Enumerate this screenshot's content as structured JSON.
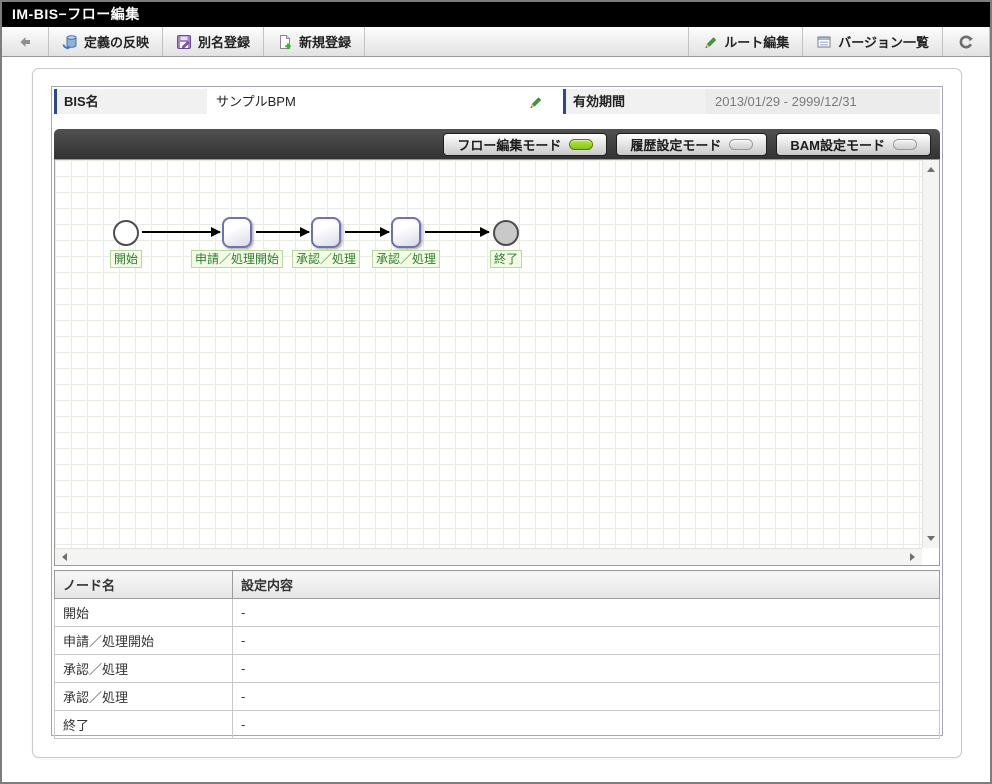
{
  "titlebar": {
    "title": "IM-BIS−フロー編集"
  },
  "toolbar": {
    "left": [
      {
        "label": "定義の反映",
        "icon": "database-sync-icon"
      },
      {
        "label": "別名登録",
        "icon": "floppy-save-icon"
      },
      {
        "label": "新規登録",
        "icon": "document-add-icon"
      }
    ],
    "right": [
      {
        "label": "ルート編集",
        "icon": "pencil-icon"
      },
      {
        "label": "バージョン一覧",
        "icon": "list-icon"
      }
    ],
    "icons": [
      "back-arrow-icon",
      "refresh-icon"
    ]
  },
  "form": {
    "bis_name_label": "BIS名",
    "bis_name_value": "サンプルBPM",
    "edit_icon": "pencil-icon",
    "period_label": "有効期間",
    "period_value": "2013/01/29 - 2999/12/31"
  },
  "modes": [
    {
      "label": "フロー編集モード",
      "active": true
    },
    {
      "label": "履歴設定モード",
      "active": false
    },
    {
      "label": "BAM設定モード",
      "active": false
    }
  ],
  "flow": {
    "nodes": [
      {
        "type": "start",
        "label": "開始"
      },
      {
        "type": "task",
        "label": "申請／処理開始"
      },
      {
        "type": "task",
        "label": "承認／処理"
      },
      {
        "type": "task",
        "label": "承認／処理"
      },
      {
        "type": "end",
        "label": "終了"
      }
    ]
  },
  "table": {
    "headers": [
      "ノード名",
      "設定内容"
    ],
    "rows": [
      [
        "開始",
        "-"
      ],
      [
        "申請／処理開始",
        "-"
      ],
      [
        "承認／処理",
        "-"
      ],
      [
        "承認／処理",
        "-"
      ],
      [
        "終了",
        "-"
      ]
    ]
  },
  "colors": {
    "titlebar_bg": "#000000",
    "accent_navy": "#2c4a8c",
    "led_active_green": "#8fd01f",
    "node_border_blue": "#7272b2",
    "label_green_text": "#2e7d32",
    "label_green_bg": "#f3fae6"
  }
}
